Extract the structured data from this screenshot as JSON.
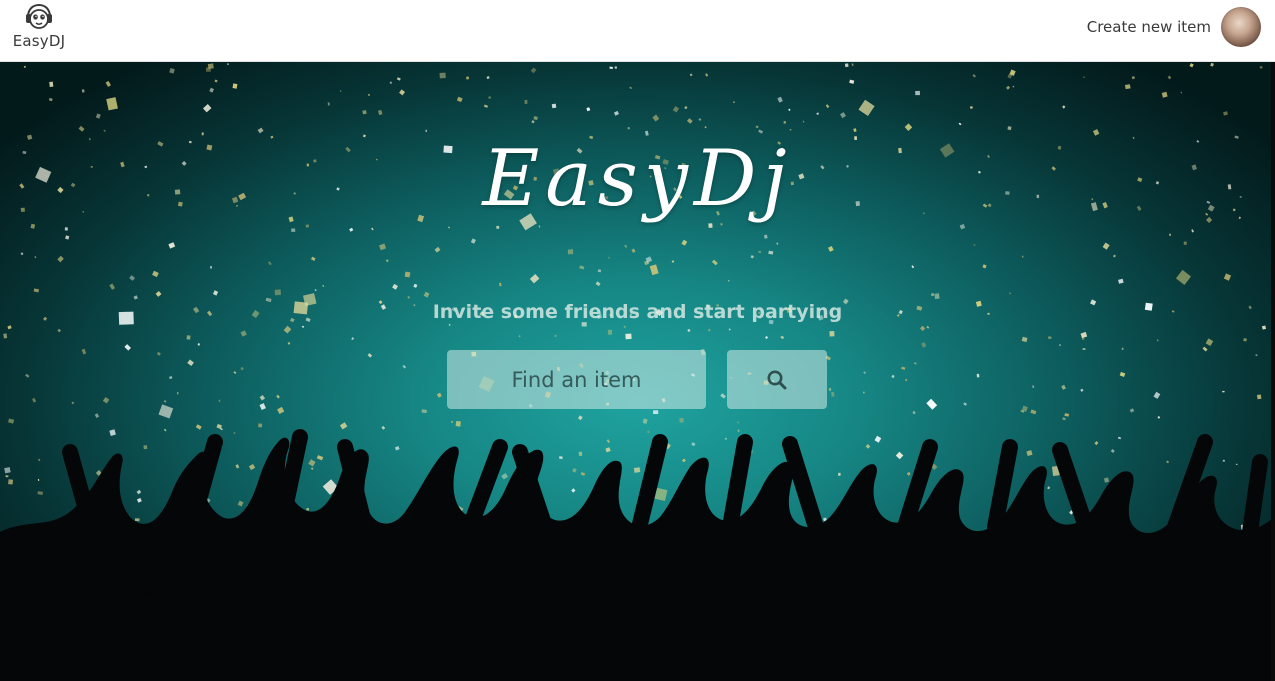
{
  "navbar": {
    "brand": {
      "logo_icon": "headphones-mascot-icon",
      "name": "EasyDJ"
    },
    "create_link": "Create new item",
    "avatar_icon": "user-avatar"
  },
  "hero": {
    "title": "EasyDj",
    "subtitle": "Invite some friends and start partying",
    "search": {
      "placeholder": "Find an item",
      "value": "",
      "button_icon": "search-icon"
    }
  },
  "colors": {
    "hero_center": "#1fa3a0",
    "hero_edge": "#031a1b",
    "text_light": "#ffffff",
    "nav_text": "#3a3a3a"
  }
}
